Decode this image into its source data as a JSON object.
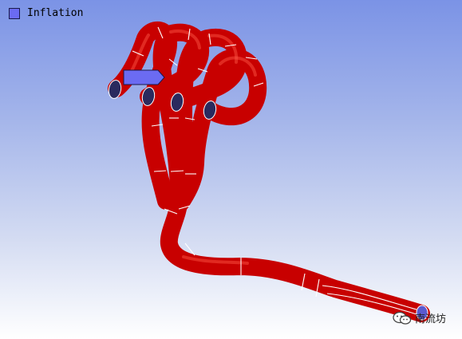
{
  "viewport": {
    "background_top": "#7b93e6",
    "background_bottom": "#ffffff"
  },
  "legend": {
    "label": "Inflation",
    "swatch_color": "#6b6bf2"
  },
  "model": {
    "pipe_color": "#c80000",
    "port_color": "#2a2a5e",
    "inlet_marker_color": "#6b6bf2",
    "outlet_color": "#5a5ad0",
    "mesh_line_color": "#ffffff"
  },
  "watermark": {
    "icon": "wechat-icon",
    "label": "南流坊"
  }
}
